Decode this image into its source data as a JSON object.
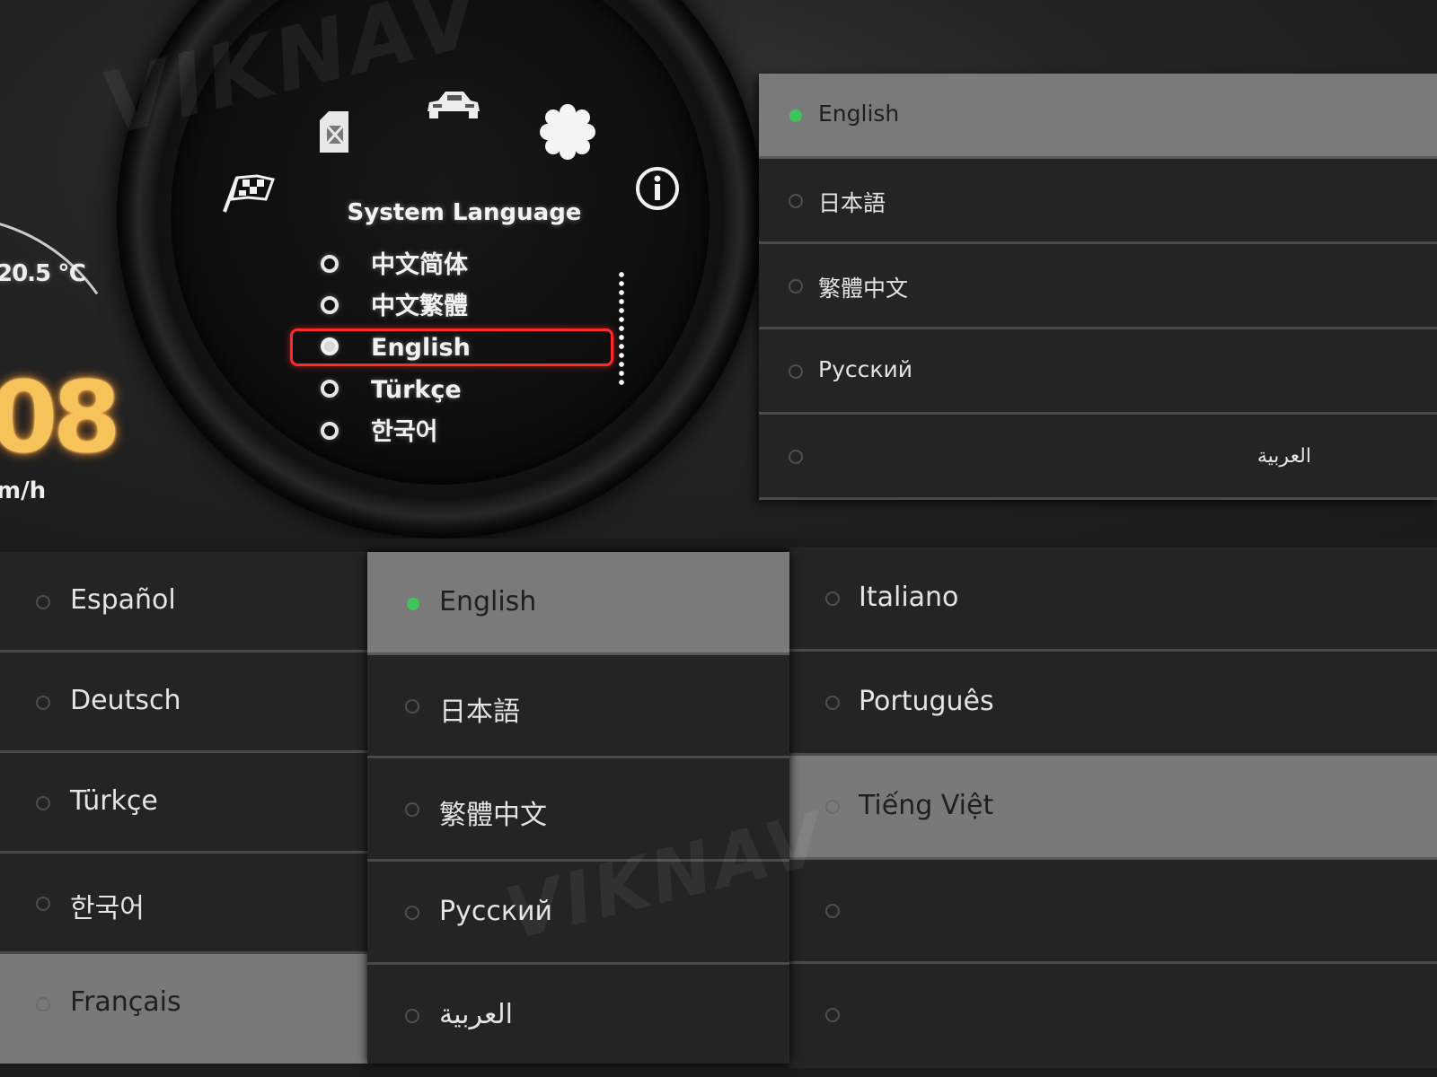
{
  "watermark": "VIKNAV",
  "cluster": {
    "temperature": "20.5 ℃",
    "speed": "08",
    "speed_unit": "m/h",
    "menu_title": "System Language",
    "icons": [
      "flag-icon",
      "fuel-icon",
      "car-icon",
      "gear-icon",
      "info-icon"
    ],
    "languages": [
      {
        "label": "中文简体",
        "selected": false
      },
      {
        "label": "中文繁體",
        "selected": false
      },
      {
        "label": "English",
        "selected": true
      },
      {
        "label": "Türkçe",
        "selected": false
      },
      {
        "label": "한국어",
        "selected": false
      }
    ],
    "highlight_color": "#ff2a2a"
  },
  "panel_top": {
    "items": [
      {
        "label": "English",
        "selected": true
      },
      {
        "label": "日本語",
        "selected": false
      },
      {
        "label": "繁體中文",
        "selected": false
      },
      {
        "label": "Русский",
        "selected": false
      },
      {
        "label": "العربية",
        "selected": false
      }
    ]
  },
  "panel_left": {
    "items": [
      {
        "label": "Español"
      },
      {
        "label": "Deutsch"
      },
      {
        "label": "Türkçe"
      },
      {
        "label": "한국어"
      },
      {
        "label": "Français"
      }
    ]
  },
  "panel_middle": {
    "items": [
      {
        "label": "English",
        "selected": true
      },
      {
        "label": "日本語"
      },
      {
        "label": "繁體中文"
      },
      {
        "label": "Русский"
      },
      {
        "label": "العربية"
      }
    ]
  },
  "panel_right": {
    "items": [
      {
        "label": "Italiano"
      },
      {
        "label": "Português"
      },
      {
        "label": "Tiếng Việt"
      },
      {
        "label": ""
      },
      {
        "label": ""
      }
    ]
  },
  "colors": {
    "selected_dot": "#3ec45a",
    "row_bg": "#242424",
    "row_selected_bg": "#7a7a7a"
  }
}
